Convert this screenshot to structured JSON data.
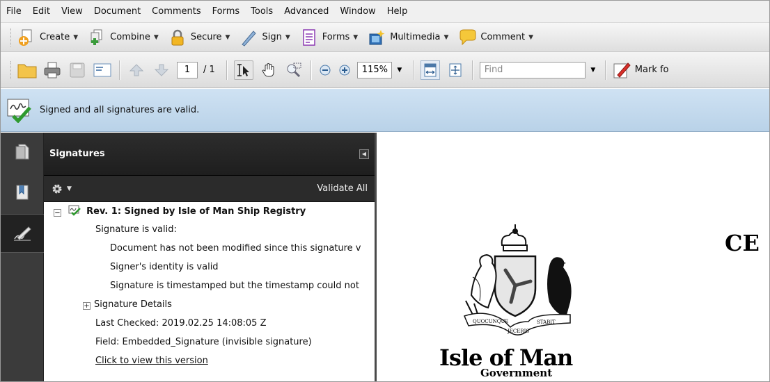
{
  "menu": [
    "File",
    "Edit",
    "View",
    "Document",
    "Comments",
    "Forms",
    "Tools",
    "Advanced",
    "Window",
    "Help"
  ],
  "toolbar1": {
    "create": "Create",
    "combine": "Combine",
    "secure": "Secure",
    "sign": "Sign",
    "forms": "Forms",
    "multimedia": "Multimedia",
    "comment": "Comment"
  },
  "toolbar2": {
    "page_current": "1",
    "page_total": "/ 1",
    "zoom": "115%",
    "find_placeholder": "Find",
    "mark_for": "Mark fo"
  },
  "signature_bar": {
    "message": "Signed and all signatures are valid."
  },
  "panel": {
    "title": "Signatures",
    "validate_all": "Validate All",
    "items": {
      "rev": "Rev. 1: Signed by Isle of Man Ship Registry",
      "valid": "Signature is valid:",
      "not_modified": "Document has not been modified since this signature v",
      "identity": "Signer's identity is valid",
      "timestamp": "Signature is timestamped but the timestamp could not",
      "details": "Signature Details",
      "last_checked": "Last Checked: 2019.02.25 14:08:05 Z",
      "field": "Field: Embedded_Signature (invisible signature)",
      "view_version": "Click to view this version"
    }
  },
  "document": {
    "heading_fragment": "CE",
    "logo_motto_left": "QUOCUNQUE",
    "logo_motto_mid": "JECERIS",
    "logo_motto_right": "STABIT",
    "logo_text": "Isle of Man",
    "logo_subtext": "Government"
  },
  "colors": {
    "signature_bar": "#c3d9ee",
    "panel_header": "#262626",
    "left_nav": "#3b3b3b"
  }
}
